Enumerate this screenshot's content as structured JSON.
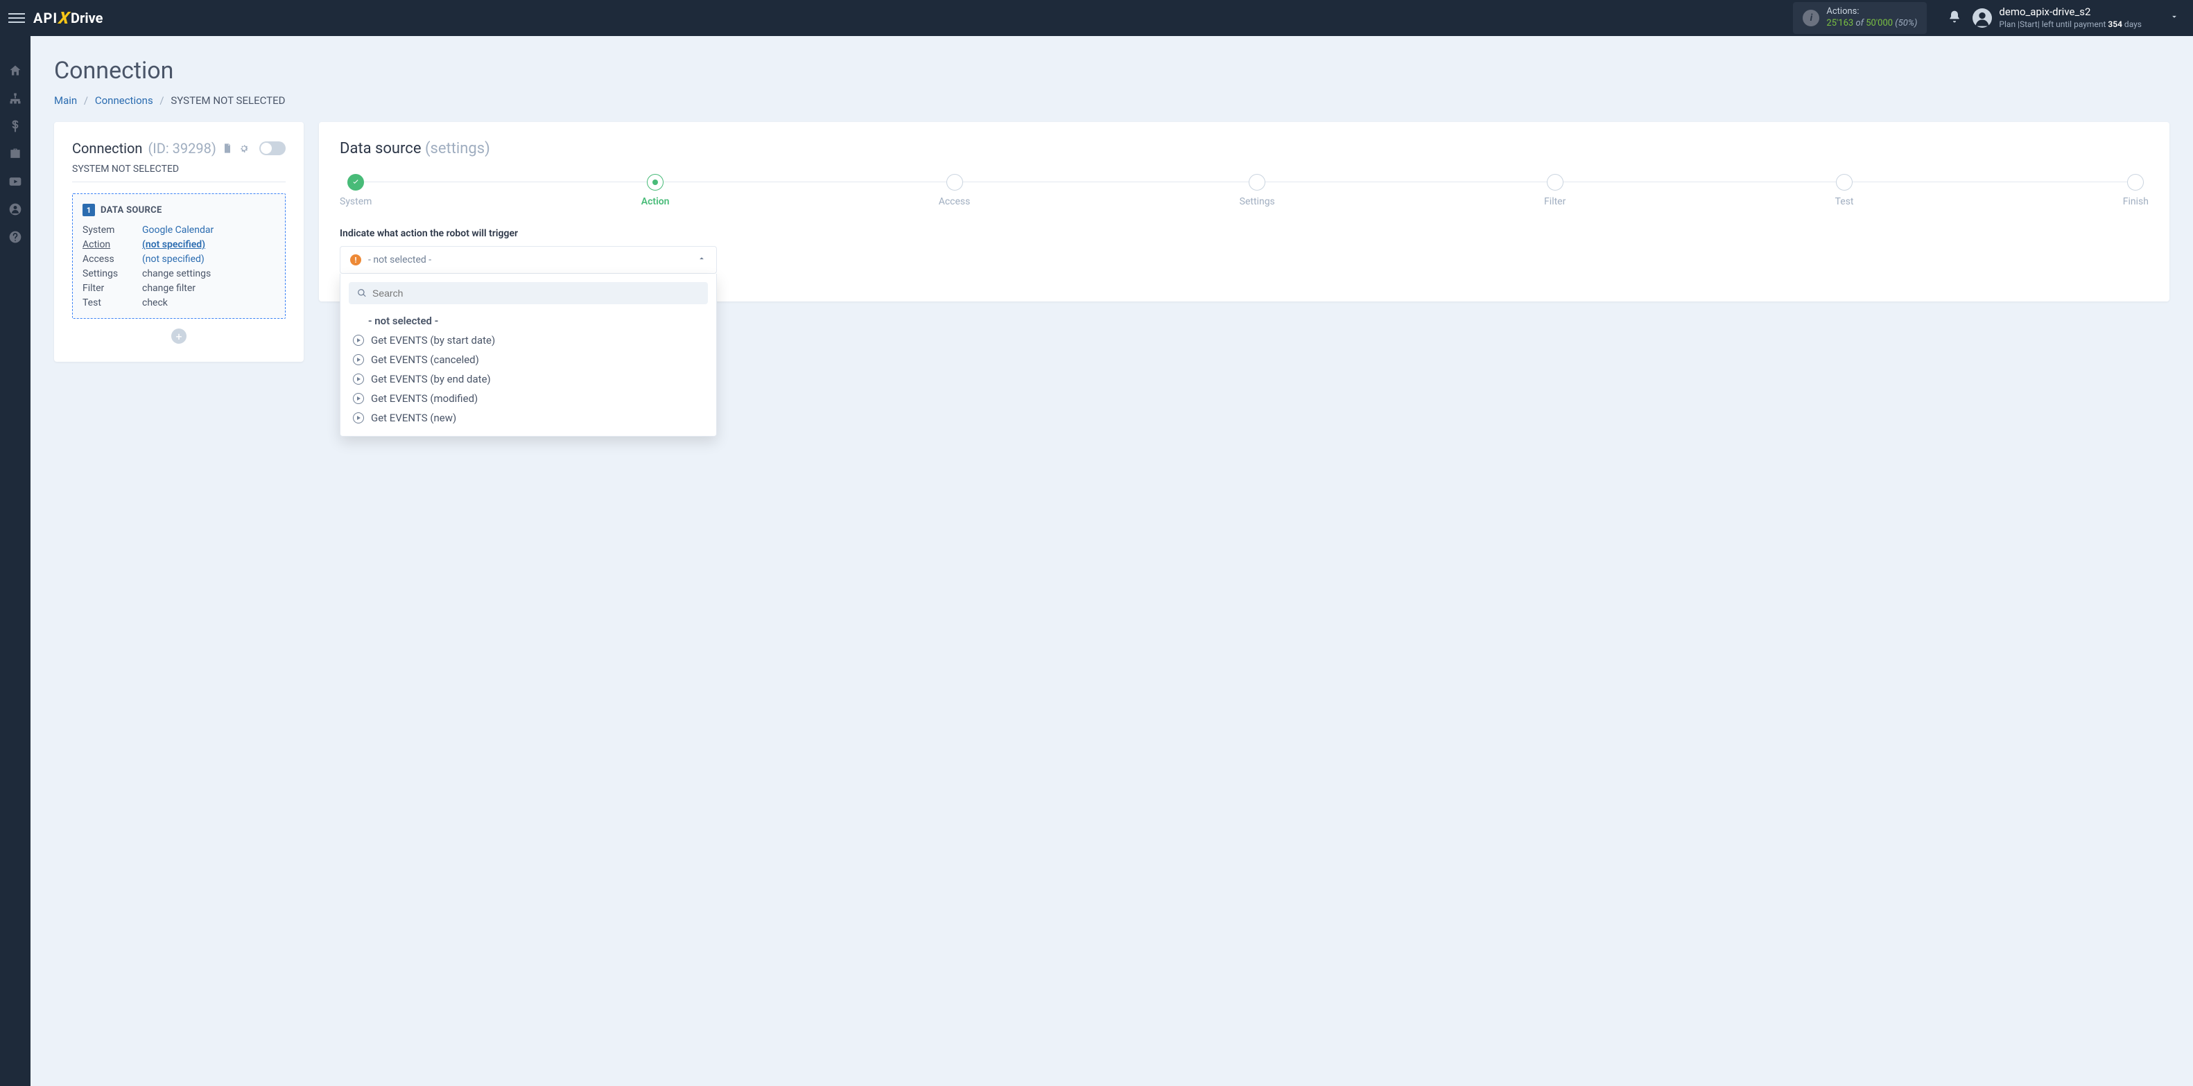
{
  "header": {
    "logo": {
      "part1": "API",
      "part2": "X",
      "part3": "Drive"
    },
    "actions": {
      "label": "Actions:",
      "count": "25'163",
      "of": "of",
      "total": "50'000",
      "pct": "(50%)"
    },
    "user": {
      "name": "demo_apix-drive_s2",
      "plan_prefix": "Plan |Start| left until payment",
      "days_num": "354",
      "days_word": "days"
    }
  },
  "page": {
    "title": "Connection",
    "breadcrumb": {
      "main": "Main",
      "connections": "Connections",
      "current": "SYSTEM NOT SELECTED"
    }
  },
  "left": {
    "title": "Connection",
    "id_label": "(ID: 39298)",
    "subtitle": "SYSTEM NOT SELECTED",
    "ds": {
      "num": "1",
      "title": "DATA SOURCE",
      "rows": {
        "system_k": "System",
        "system_v": "Google Calendar",
        "action_k": "Action",
        "action_v": "(not specified)",
        "access_k": "Access",
        "access_v": "(not specified)",
        "settings_k": "Settings",
        "settings_v": "change settings",
        "filter_k": "Filter",
        "filter_v": "change filter",
        "test_k": "Test",
        "test_v": "check"
      }
    }
  },
  "right": {
    "title": "Data source",
    "subtitle": "(settings)",
    "steps": [
      "System",
      "Action",
      "Access",
      "Settings",
      "Filter",
      "Test",
      "Finish"
    ],
    "field_label": "Indicate what action the robot will trigger",
    "select_value": "- not selected -",
    "search_placeholder": "Search",
    "options": [
      "- not selected -",
      "Get EVENTS (by start date)",
      "Get EVENTS (canceled)",
      "Get EVENTS (by end date)",
      "Get EVENTS (modified)",
      "Get EVENTS (new)"
    ]
  }
}
